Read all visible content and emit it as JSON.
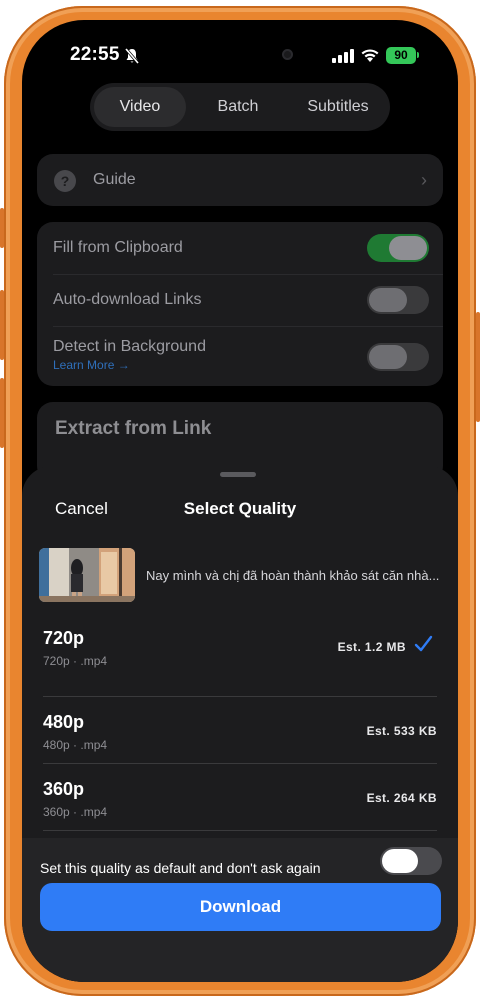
{
  "status_bar": {
    "time": "22:55",
    "battery": "90",
    "battery_color": "#34c759"
  },
  "tabs": [
    {
      "label": "Video",
      "active": true
    },
    {
      "label": "Batch",
      "active": false
    },
    {
      "label": "Subtitles",
      "active": false
    }
  ],
  "guide": {
    "label": "Guide",
    "icon": "question-circle-icon"
  },
  "settings": [
    {
      "label": "Fill from Clipboard",
      "on": true
    },
    {
      "label": "Auto-download Links",
      "on": false
    },
    {
      "label": "Detect in Background",
      "on": false,
      "link": "Learn More →"
    }
  ],
  "extract": {
    "title": "Extract from Link"
  },
  "sheet": {
    "cancel_label": "Cancel",
    "title": "Select Quality",
    "video_title": "Nay mình và chị đã hoàn thành khảo sát căn nhà..."
  },
  "qualities": [
    {
      "name": "720p",
      "sub": "720p · .mp4",
      "size": "Est. 1.2 MB",
      "selected": true
    },
    {
      "name": "480p",
      "sub": "480p · .mp4",
      "size": "Est. 533 KB",
      "selected": false
    },
    {
      "name": "360p",
      "sub": "360p · .mp4",
      "size": "Est. 264 KB",
      "selected": false
    }
  ],
  "default_toggle": {
    "label": "Set this quality as default and don't ask again",
    "on": false
  },
  "download_label": "Download",
  "colors": {
    "accent": "#2f7cf6",
    "toggle_on": "#1f7a33",
    "frame": "#e9852f"
  }
}
